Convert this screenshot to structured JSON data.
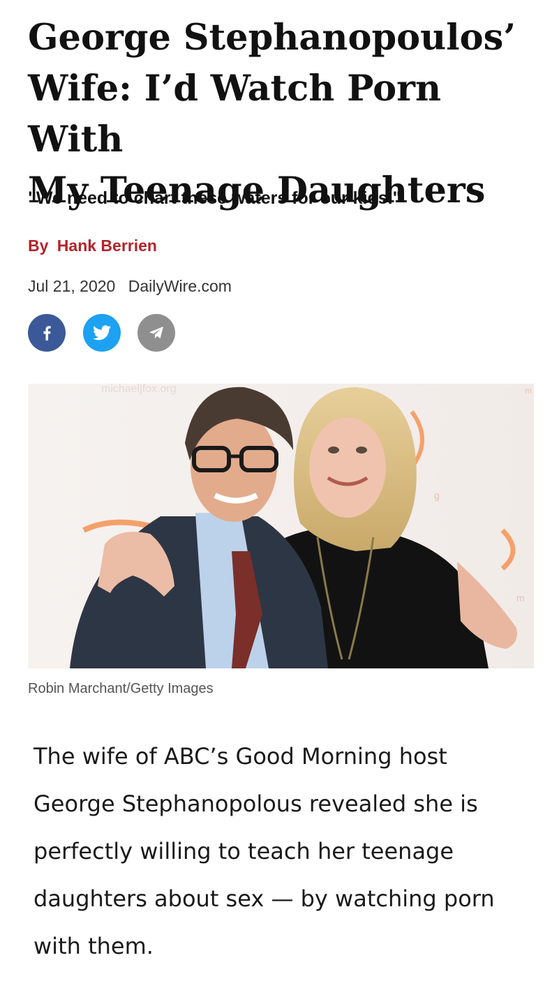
{
  "article": {
    "headline_lines": [
      "George Stephanopoulos’",
      "Wife: I’d Watch Porn With",
      "My Teenage Daughters"
    ],
    "subhead": "\"We need to chart these waters for our kids.\"",
    "byline_prefix": "By",
    "author": "Hank Berrien",
    "date": "Jul 21, 2020",
    "source": "DailyWire.com",
    "photo_credit": "Robin Marchant/Getty Images",
    "body_lines": [
      "The wife of ABC’s Good Morning host",
      "George Stephanopolous revealed she is",
      "perfectly willing to teach her teenage",
      "daughters about sex — by watching porn",
      "with them."
    ]
  },
  "share": {
    "facebook_icon": "facebook-icon",
    "twitter_icon": "twitter-icon",
    "telegram_icon": "telegram-icon"
  },
  "colors": {
    "byline": "#b3232a",
    "facebook": "#3b5998",
    "twitter": "#1da1f2",
    "telegram": "#8f8f8f",
    "backdrop_logo": "#f5a06b"
  },
  "photo": {
    "backdrop_text": [
      "michaeljfox.org",
      "m",
      "m",
      "g"
    ]
  }
}
